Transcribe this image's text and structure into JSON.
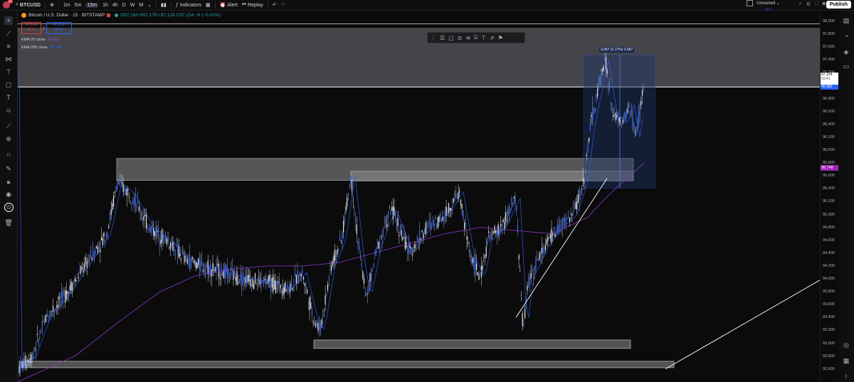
{
  "topbar": {
    "symbol": "BTCUSD",
    "timeframes": [
      "1m",
      "5m",
      "15m",
      "1h",
      "4h",
      "D",
      "W",
      "M"
    ],
    "active_timeframe": "15m",
    "indicators_label": "Indicators",
    "alert_label": "Alert",
    "replay_label": "Replay",
    "layout_name": "Unnamed",
    "layout_sub": "Save",
    "publish_label": "Publish",
    "notif_count": "11"
  },
  "legend": {
    "title": "Bitcoin / U.S. Dollar · 15 · BITSTAMP",
    "ohlc": "O97,160 H97,178 L97,128 C97,154 −6 (−0.01%)",
    "sell_price": "97,150",
    "sell_label": "SELL",
    "buy_price": "97,152",
    "buy_label": "BUY",
    "spread": "2",
    "ema1_label": "EMA 20 close",
    "ema1_value": "96,983",
    "ema2_label": "EMA 200 close",
    "ema2_value": "95,748"
  },
  "price_axis": {
    "ticks": [
      "98,000",
      "97,800",
      "97,600",
      "97,400",
      "97,200",
      "97,000",
      "96,800",
      "96,600",
      "96,400",
      "96,200",
      "96,000",
      "95,800",
      "95,600",
      "95,400",
      "95,200",
      "95,000",
      "94,800",
      "94,600",
      "94,400",
      "94,200",
      "94,000",
      "93,800",
      "93,600",
      "93,400",
      "93,200",
      "93,000",
      "92,800",
      "92,600"
    ],
    "current_price": "97,154",
    "countdown": "09:41",
    "ema20_tag": "96,983",
    "ema200_tag": "95,748"
  },
  "measure_label": "2,067 (2.17%) 2,067",
  "colors": {
    "accent": "#2962ff",
    "up": "#26a69a",
    "down": "#e23c3c",
    "ema": "#9c27b0"
  },
  "icons": {
    "left": [
      "crosshair-icon",
      "trend-line-icon",
      "fib-icon",
      "pattern-icon",
      "projection-icon",
      "brush-icon",
      "text-icon",
      "emoji-icon",
      "ruler-icon",
      "zoom-icon",
      "magnet-icon",
      "lock-drawing-icon",
      "lock-icon",
      "eye-icon",
      "trash-icon"
    ],
    "right": [
      "watchlist-icon",
      "alerts-icon",
      "layers-icon",
      "chat-icon",
      "target-icon",
      "calendar-icon",
      "help-icon"
    ]
  }
}
